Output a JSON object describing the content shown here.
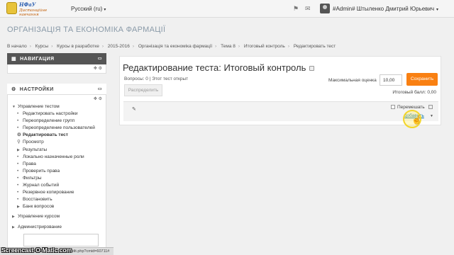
{
  "topbar": {
    "logo_line1": "НФаУ",
    "logo_line2": "Дистанційне навчання",
    "language": "Русский (ru)",
    "user_name": "#Admin# Штыленко Дмитрий Юрьевич"
  },
  "site_title": "ОРГАНІЗАЦІЯ ТА ЕКОНОМІКА ФАРМАЦІЇ",
  "breadcrumb": [
    "В начало",
    "Курсы",
    "Курсы в разработке",
    "2015-2016",
    "Організація та економіка фармації",
    "Тема 8",
    "Итоговый контроль",
    "Редактировать тест"
  ],
  "nav_block": {
    "title": "НАВИГАЦИЯ"
  },
  "settings_block": {
    "title": "НАСТРОЙКИ",
    "test_admin": "Управление тестом",
    "items": [
      {
        "label": "Редактировать настройки",
        "marker": "dot"
      },
      {
        "label": "Переопределение групп",
        "marker": "dot"
      },
      {
        "label": "Переопределение пользователей",
        "marker": "dot"
      },
      {
        "label": "Редактировать тест",
        "marker": "gear",
        "active": true
      },
      {
        "label": "Просмотр",
        "marker": "search"
      },
      {
        "label": "Результаты",
        "marker": "tri"
      },
      {
        "label": "Локально назначенные роли",
        "marker": "dot"
      },
      {
        "label": "Права",
        "marker": "dot"
      },
      {
        "label": "Проверить права",
        "marker": "dot"
      },
      {
        "label": "Фильтры",
        "marker": "dot"
      },
      {
        "label": "Журнал событий",
        "marker": "dot"
      },
      {
        "label": "Резервное копирование",
        "marker": "dot"
      },
      {
        "label": "Восстановить",
        "marker": "dot"
      },
      {
        "label": "Банк вопросов",
        "marker": "tri"
      }
    ],
    "course_admin": "Управление курсом",
    "site_admin": "Администрирование"
  },
  "main": {
    "title": "Редактирование теста: Итоговый контроль",
    "questions_info": "Вопросы: 0 | Этот тест открыт",
    "distribute_button": "Распределить",
    "max_grade_label": "Максимальная оценка",
    "max_grade_value": "10,00",
    "save_button": "Сохранить",
    "total_grade": "Итоговый балл: 0,00",
    "shuffle_label": "Перемешать",
    "add_link": "Добавить"
  },
  "status_url": "dit.php?cmid=60711#",
  "watermark": "Screencast-O-Matic.com"
}
